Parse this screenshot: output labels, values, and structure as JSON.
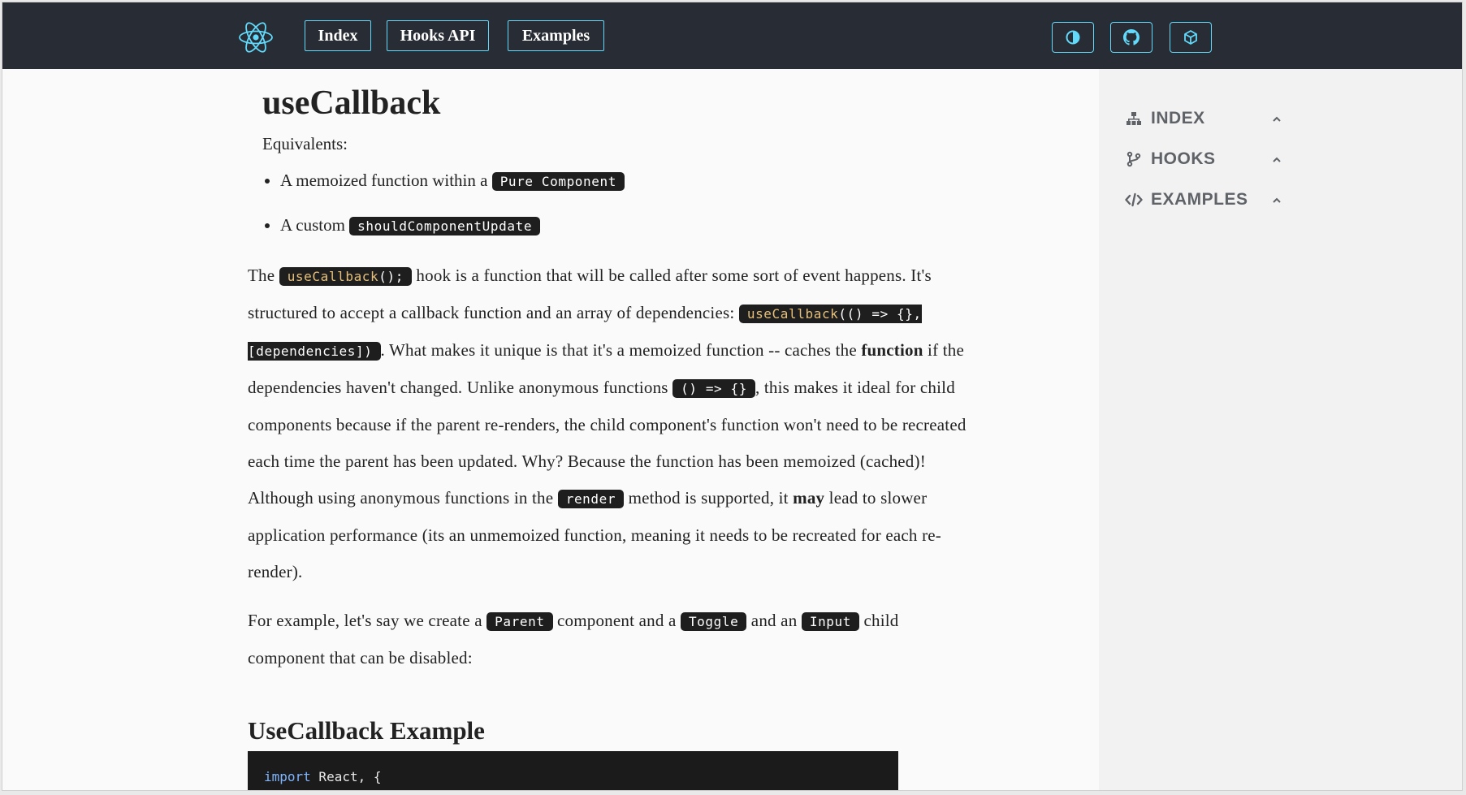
{
  "header": {
    "nav": [
      {
        "label": "Index"
      },
      {
        "label": "Hooks API"
      },
      {
        "label": "Examples"
      }
    ],
    "icons": [
      "theme-toggle-icon",
      "github-icon",
      "package-icon"
    ],
    "accent_color": "#61dafb",
    "background_color": "#282c34"
  },
  "sidebar": {
    "items": [
      {
        "label": "INDEX",
        "icon": "sitemap-icon"
      },
      {
        "label": "HOOKS",
        "icon": "code-branch-icon"
      },
      {
        "label": "EXAMPLES",
        "icon": "code-icon"
      }
    ]
  },
  "article": {
    "title": "useCallback",
    "equivalents_label": "Equivalents:",
    "equivalents": [
      {
        "text": "A memoized function within a",
        "code": "Pure Component"
      },
      {
        "text": "A custom",
        "code": "shouldComponentUpdate"
      }
    ],
    "p1": {
      "t1": "The",
      "code1_fn": "useCallback",
      "code1_rest": "();",
      "t2": "hook is a function that will be called after some sort of event happens. It's structured to accept a callback function and an array of dependencies:",
      "code2_fn": "useCallback",
      "code2_rest": "(() => {}, [dependencies])",
      "t3": ". What makes it unique is that it's a memoized function -- caches the",
      "b1": "function",
      "t4": "if the dependencies haven't changed. Unlike anonymous functions",
      "code3": "() => {}",
      "t5": ", this makes it ideal for child components because if the parent re-renders, the child component's function won't need to be recreated each time the parent has been updated. Why? Because the function has been memoized (cached)! Although using anonymous functions in the",
      "code4": "render",
      "t6": "method is supported, it",
      "b2": "may",
      "t7": "lead to slower application performance (its an unmemoized function, meaning it needs to be recreated for each re-render)."
    },
    "p2": {
      "t1": "For example, let's say we create a",
      "code1": "Parent",
      "t2": "component and a",
      "code2": "Toggle",
      "t3": "and an",
      "code3": "Input",
      "t4": "child component that can be disabled:"
    },
    "example_title": "UseCallback Example",
    "code_sample": {
      "line1_kw": "import",
      "line1_rest": " React, {"
    }
  }
}
